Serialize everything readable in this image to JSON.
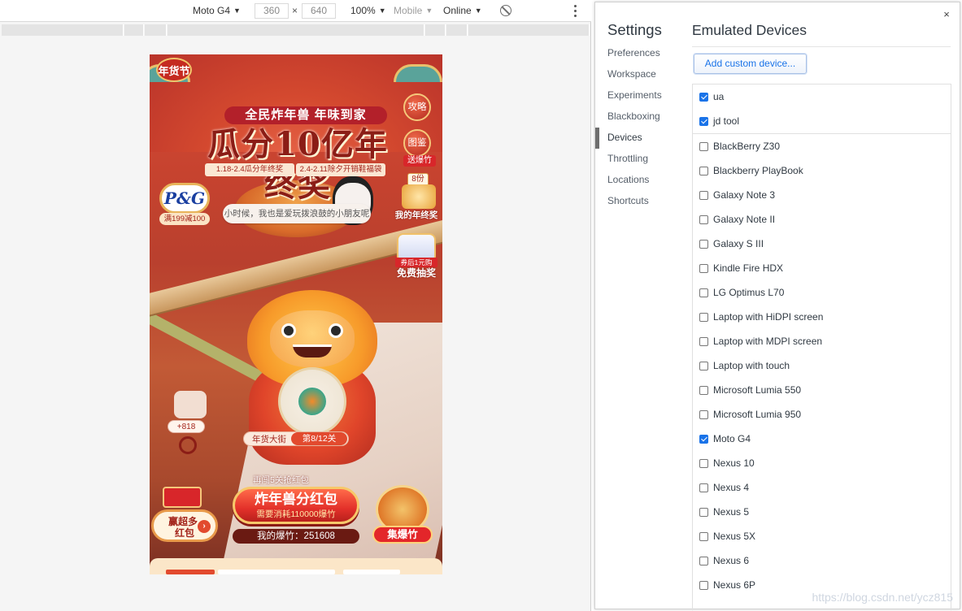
{
  "devbar": {
    "device": "Moto G4",
    "width": "360",
    "height": "640",
    "zoom": "100%",
    "mobile": "Mobile",
    "network": "Online",
    "caret": "▼",
    "times": "×",
    "rotate_icon": "rotate-icon",
    "more_icon": "kebab-icon"
  },
  "viewport": {
    "tag": "年货节",
    "slogan": "全民炸年兽 年味到家",
    "headline": "瓜分10亿年终奖",
    "dates": [
      "1.18-2.4瓜分年终奖",
      "2.4-2.11除夕开销鞋福袋"
    ],
    "strategy_btn": "攻略",
    "guide_btn": "图鉴",
    "firecracker_tag": "送爆竹",
    "award_count": "8份",
    "my_award": "我的年终奖",
    "draw_sub": "券后1元购",
    "free_draw": "免费抽奖",
    "brand_logo": "P&G",
    "brand_deal": "满199减100",
    "bubble": "小时候，我也是爱玩拨浪鼓的小朋友呢",
    "ox_badge": "+818",
    "street_label": "年货大街",
    "street_level": "第8/12关",
    "more_line1": "赢超多",
    "more_line2": "红包",
    "more_arrow": "›",
    "unlock": "再闯5关抢红包",
    "main_btn_title": "炸年兽分红包",
    "main_btn_sub": "需要消耗110000爆竹",
    "firecracker_count": "我的爆竹：251608",
    "collect_btn": "集爆竹"
  },
  "settings": {
    "title": "Settings",
    "close": "×",
    "nav": [
      {
        "label": "Preferences",
        "active": false
      },
      {
        "label": "Workspace",
        "active": false
      },
      {
        "label": "Experiments",
        "active": false
      },
      {
        "label": "Blackboxing",
        "active": false
      },
      {
        "label": "Devices",
        "active": true
      },
      {
        "label": "Throttling",
        "active": false
      },
      {
        "label": "Locations",
        "active": false
      },
      {
        "label": "Shortcuts",
        "active": false
      }
    ],
    "content_title": "Emulated Devices",
    "add_button": "Add custom device...",
    "custom_devices": [
      {
        "label": "ua",
        "checked": true
      },
      {
        "label": "jd tool",
        "checked": true
      }
    ],
    "devices": [
      {
        "label": "BlackBerry Z30",
        "checked": false
      },
      {
        "label": "Blackberry PlayBook",
        "checked": false
      },
      {
        "label": "Galaxy Note 3",
        "checked": false
      },
      {
        "label": "Galaxy Note II",
        "checked": false
      },
      {
        "label": "Galaxy S III",
        "checked": false
      },
      {
        "label": "Kindle Fire HDX",
        "checked": false
      },
      {
        "label": "LG Optimus L70",
        "checked": false
      },
      {
        "label": "Laptop with HiDPI screen",
        "checked": false
      },
      {
        "label": "Laptop with MDPI screen",
        "checked": false
      },
      {
        "label": "Laptop with touch",
        "checked": false
      },
      {
        "label": "Microsoft Lumia 550",
        "checked": false
      },
      {
        "label": "Microsoft Lumia 950",
        "checked": false
      },
      {
        "label": "Moto G4",
        "checked": true
      },
      {
        "label": "Nexus 10",
        "checked": false
      },
      {
        "label": "Nexus 4",
        "checked": false
      },
      {
        "label": "Nexus 5",
        "checked": false
      },
      {
        "label": "Nexus 5X",
        "checked": false
      },
      {
        "label": "Nexus 6",
        "checked": false
      },
      {
        "label": "Nexus 6P",
        "checked": false
      }
    ]
  },
  "watermark": "https://blog.csdn.net/ycz815",
  "colors": {
    "accent_blue": "#1a73e8",
    "checkbox_checked": "#1a73e8",
    "active_nav_marker": "#6e6e6e",
    "promo_red": "#d8262a"
  }
}
